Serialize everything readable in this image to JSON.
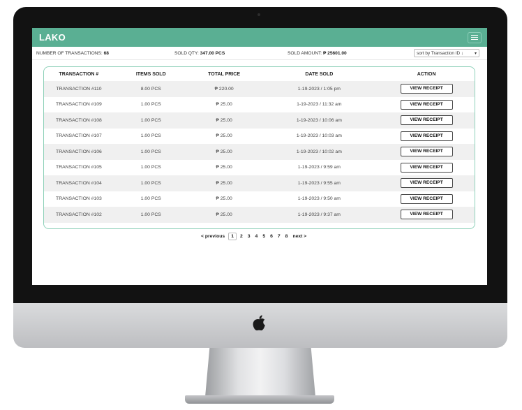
{
  "app": {
    "title": "LAKO"
  },
  "stats": {
    "transactions_label": "NUMBER OF TRANSACTIONS:",
    "transactions_value": "68",
    "sold_qty_label": "SOLD QTY:",
    "sold_qty_value": "347.00 PCS",
    "sold_amount_label": "SOLD AMOUNT:",
    "sold_amount_value": "₱ 25601.00",
    "sort_selected": "sort by Transaction ID ↓"
  },
  "table": {
    "headers": [
      "TRANSACTION #",
      "ITEMS SOLD",
      "TOTAL PRICE",
      "DATE SOLD",
      "ACTION"
    ],
    "action_label": "VIEW RECEIPT",
    "rows": [
      {
        "id": "TRANSACTION #110",
        "items": "8.00 PCS",
        "price": "₱ 220.00",
        "date": "1-19-2023 / 1:05 pm"
      },
      {
        "id": "TRANSACTION #109",
        "items": "1.00 PCS",
        "price": "₱ 25.00",
        "date": "1-19-2023 / 11:32 am"
      },
      {
        "id": "TRANSACTION #108",
        "items": "1.00 PCS",
        "price": "₱ 25.00",
        "date": "1-19-2023 / 10:06 am"
      },
      {
        "id": "TRANSACTION #107",
        "items": "1.00 PCS",
        "price": "₱ 25.00",
        "date": "1-19-2023 / 10:03 am"
      },
      {
        "id": "TRANSACTION #106",
        "items": "1.00 PCS",
        "price": "₱ 25.00",
        "date": "1-19-2023 / 10:02 am"
      },
      {
        "id": "TRANSACTION #105",
        "items": "1.00 PCS",
        "price": "₱ 25.00",
        "date": "1-19-2023 / 9:59 am"
      },
      {
        "id": "TRANSACTION #104",
        "items": "1.00 PCS",
        "price": "₱ 25.00",
        "date": "1-19-2023 / 9:55 am"
      },
      {
        "id": "TRANSACTION #103",
        "items": "1.00 PCS",
        "price": "₱ 25.00",
        "date": "1-19-2023 / 9:50 am"
      },
      {
        "id": "TRANSACTION #102",
        "items": "1.00 PCS",
        "price": "₱ 25.00",
        "date": "1-19-2023 / 9:37 am"
      }
    ]
  },
  "pagination": {
    "previous": "< previous",
    "next": "next >",
    "pages": [
      "1",
      "2",
      "3",
      "4",
      "5",
      "6",
      "7",
      "8"
    ],
    "current": "1"
  },
  "icons": {
    "menu": "hamburger-menu-icon",
    "device_logo": "apple-logo-icon",
    "sort_caret": "chevron-down-icon"
  },
  "colors": {
    "accent": "#5aaf93",
    "table_border": "#8fd1ba"
  }
}
